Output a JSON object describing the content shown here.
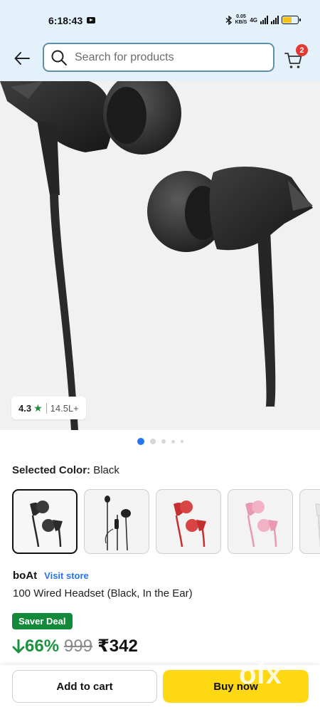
{
  "status_bar": {
    "time": "6:18:43",
    "speed": "0.05",
    "speed_unit": "KB/S",
    "network": "4G"
  },
  "header": {
    "search": {
      "placeholder": "Search for products"
    },
    "cart_count": "2"
  },
  "gallery": {
    "rating": "4.3",
    "rating_count": "14.5L+",
    "dot_count": 5,
    "active_dot": 0
  },
  "product": {
    "selected_color_label": "Selected Color:",
    "selected_color": "Black",
    "swatches": [
      "black",
      "black-inline-mic",
      "red",
      "pink",
      "white"
    ],
    "brand": "boAt",
    "visit_store": "Visit store",
    "title": "100 Wired Headset (Black, In the Ear)",
    "saver_deal": "Saver Deal",
    "discount": "66%",
    "mrp": "999",
    "price": "₹342"
  },
  "actions": {
    "add_to_cart": "Add to cart",
    "buy_now": "Buy now"
  },
  "watermark": "olx",
  "colors": {
    "header_bg": "#e3f1fb",
    "accent_blue": "#2874f0",
    "deal_green": "#128a3a",
    "buy_yellow": "#ffd814",
    "badge_red": "#e53935"
  }
}
